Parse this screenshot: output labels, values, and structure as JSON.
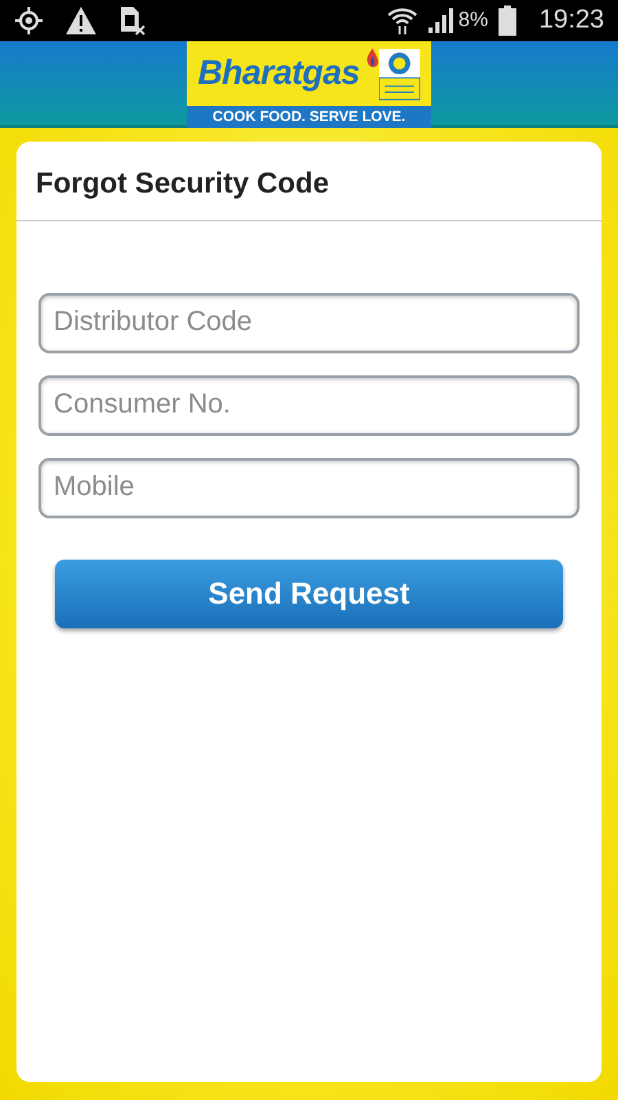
{
  "status_bar": {
    "battery": "8%",
    "time": "19:23"
  },
  "logo": {
    "brand": "Bharatgas",
    "tagline": "COOK FOOD. SERVE LOVE."
  },
  "title": "Forgot Security Code",
  "fields": [
    {
      "placeholder": "Distributor Code"
    },
    {
      "placeholder": "Consumer No."
    },
    {
      "placeholder": "Mobile"
    }
  ],
  "button": "Send Request"
}
